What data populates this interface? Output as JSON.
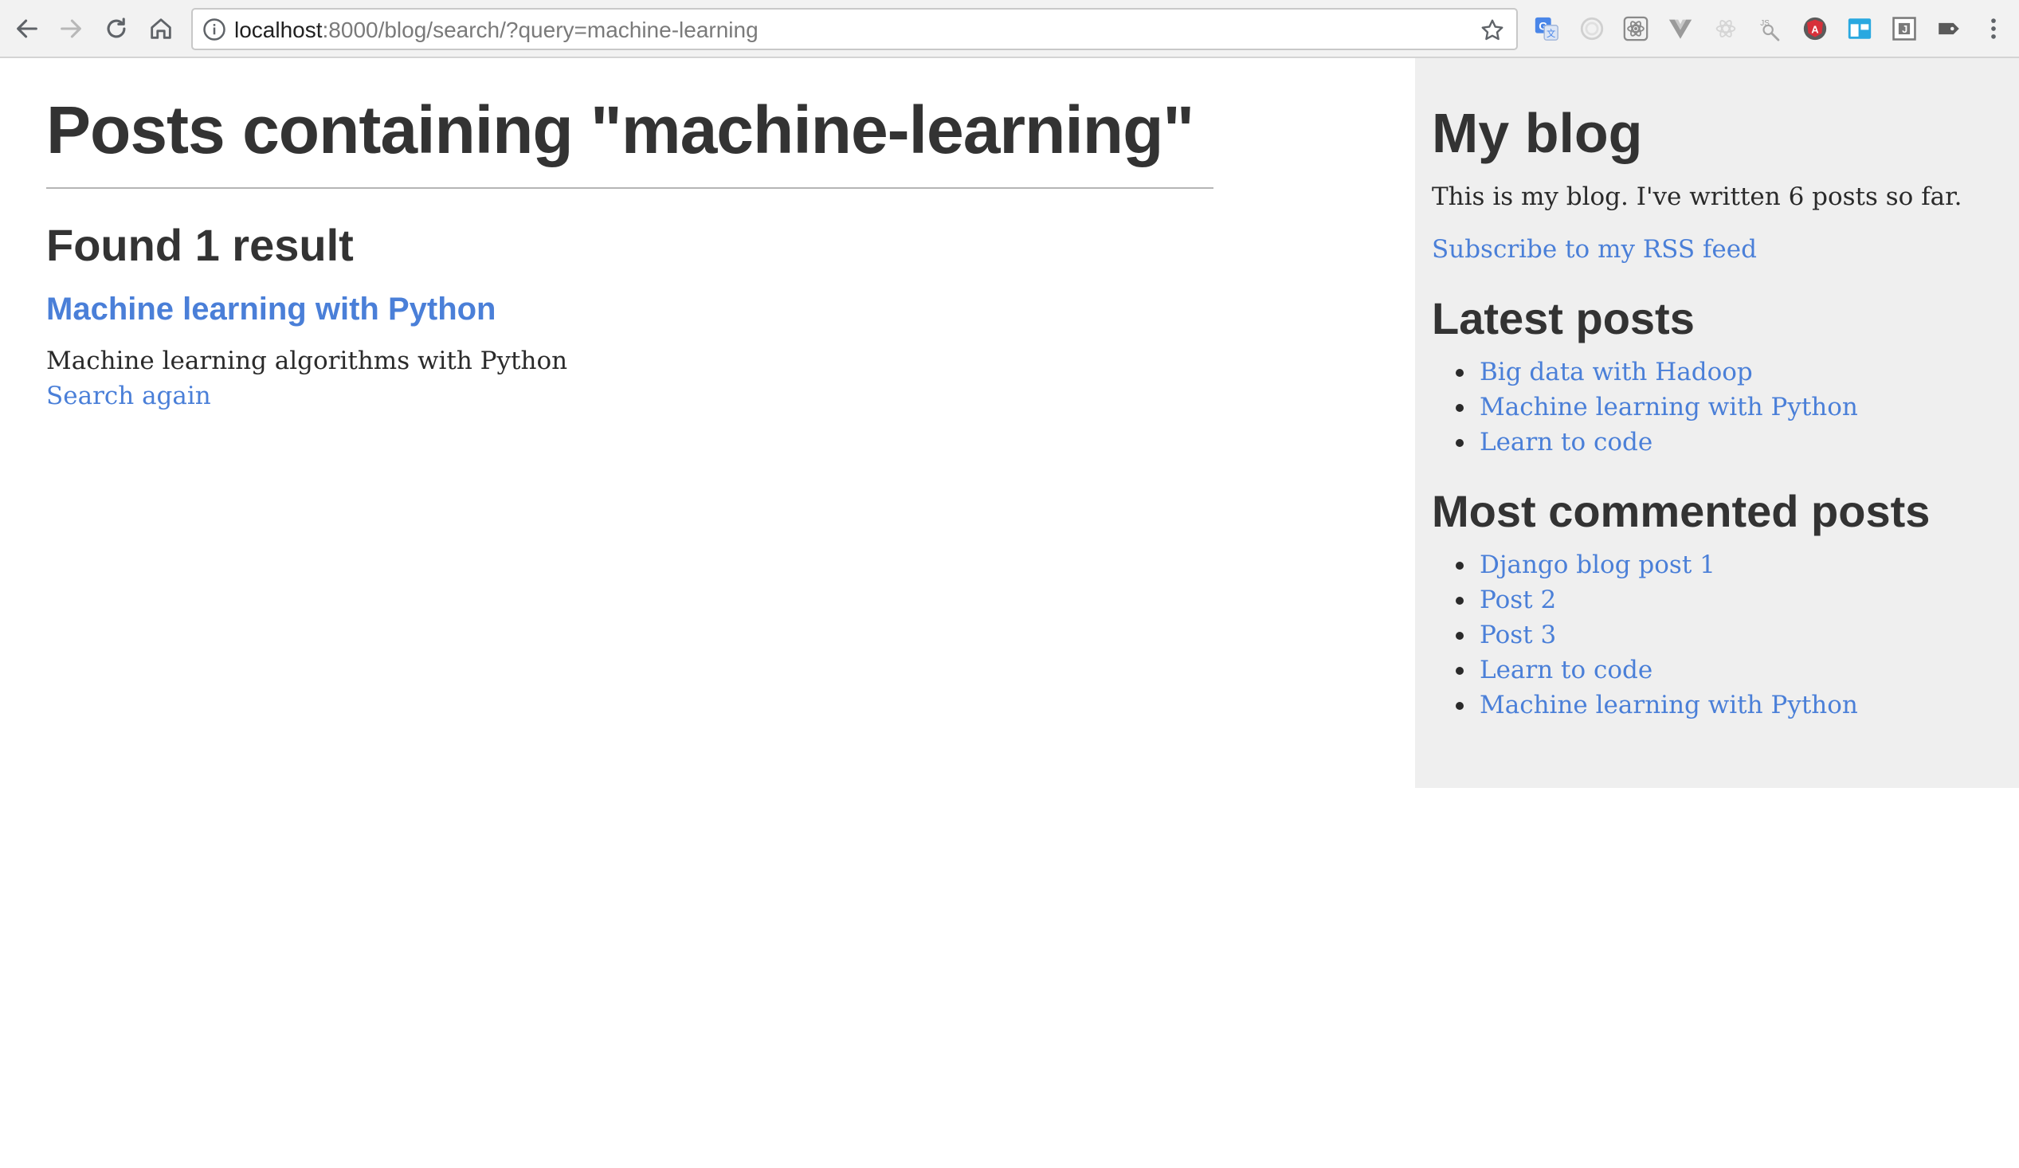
{
  "browser": {
    "url_host": "localhost",
    "url_path": ":8000/blog/search/?query=machine-learning",
    "nav_icons": [
      "back-arrow-icon",
      "forward-arrow-icon",
      "reload-icon",
      "home-icon"
    ],
    "extension_icons": [
      "google-translate-icon",
      "circle-extension-icon",
      "react-devtools-icon",
      "vue-devtools-icon",
      "atom-extension-icon",
      "js-search-icon",
      "angular-icon",
      "window-extension-icon",
      "j-extension-icon",
      "tag-extension-icon"
    ],
    "menu_icon": "kebab-menu-icon"
  },
  "main": {
    "title": "Posts containing \"machine-learning\"",
    "results_count": "Found 1 result",
    "results": [
      {
        "title": "Machine learning with Python",
        "snippet": "Machine learning algorithms with Python"
      }
    ],
    "search_again": "Search again"
  },
  "sidebar": {
    "blog_title": "My blog",
    "description": "This is my blog. I've written 6 posts so far.",
    "rss_link": "Subscribe to my RSS feed",
    "latest_title": "Latest posts",
    "latest_posts": [
      "Big data with Hadoop",
      "Machine learning with Python",
      "Learn to code"
    ],
    "most_commented_title": "Most commented posts",
    "most_commented_posts": [
      "Django blog post 1",
      "Post 2",
      "Post 3",
      "Learn to code",
      "Machine learning with Python"
    ]
  },
  "colors": {
    "link": "#4a7fd8",
    "sidebar_bg": "#efefef",
    "text": "#333333"
  }
}
